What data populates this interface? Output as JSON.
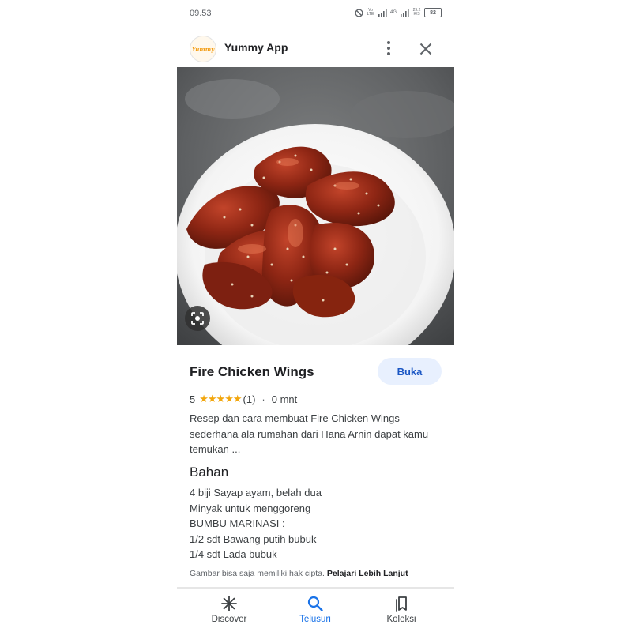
{
  "status_bar": {
    "time": "09.53",
    "volte": "Vo LTE",
    "network": "4G",
    "speed": "29.2 K/S",
    "battery": "82"
  },
  "app_bar": {
    "logo_text": "Yummy",
    "title": "Yummy App",
    "more_icon": "more-vert-icon",
    "close_icon": "close-icon"
  },
  "hero": {
    "image": "fire-chicken-wings-photo",
    "lens_icon": "lens-icon"
  },
  "recipe": {
    "title": "Fire Chicken Wings",
    "open_label": "Buka",
    "rating": "5",
    "stars": "★★★★★",
    "rating_count": "(1)",
    "separator": "·",
    "duration": "0 mnt",
    "description": "Resep dan cara membuat Fire Chicken Wings sederhana ala rumahan dari Hana Arnin dapat kamu temukan ...",
    "ingredients_title": "Bahan",
    "ingredients": [
      "4 biji Sayap ayam, belah dua",
      "Minyak untuk menggoreng",
      "BUMBU MARINASI :",
      "1/2 sdt Bawang putih bubuk",
      "1/4 sdt Lada bubuk"
    ],
    "copyright_text": "Gambar bisa saja memiliki hak cipta.",
    "learn_more": "Pelajari Lebih Lanjut"
  },
  "bottom_nav": {
    "items": [
      {
        "label": "Discover",
        "icon": "asterisk-icon",
        "active": false
      },
      {
        "label": "Telusuri",
        "icon": "search-icon",
        "active": true
      },
      {
        "label": "Koleksi",
        "icon": "bookmarks-icon",
        "active": false
      }
    ]
  },
  "colors": {
    "accent": "#1a73e8",
    "button_bg": "#e8f0fe",
    "star": "#f2a60d"
  }
}
